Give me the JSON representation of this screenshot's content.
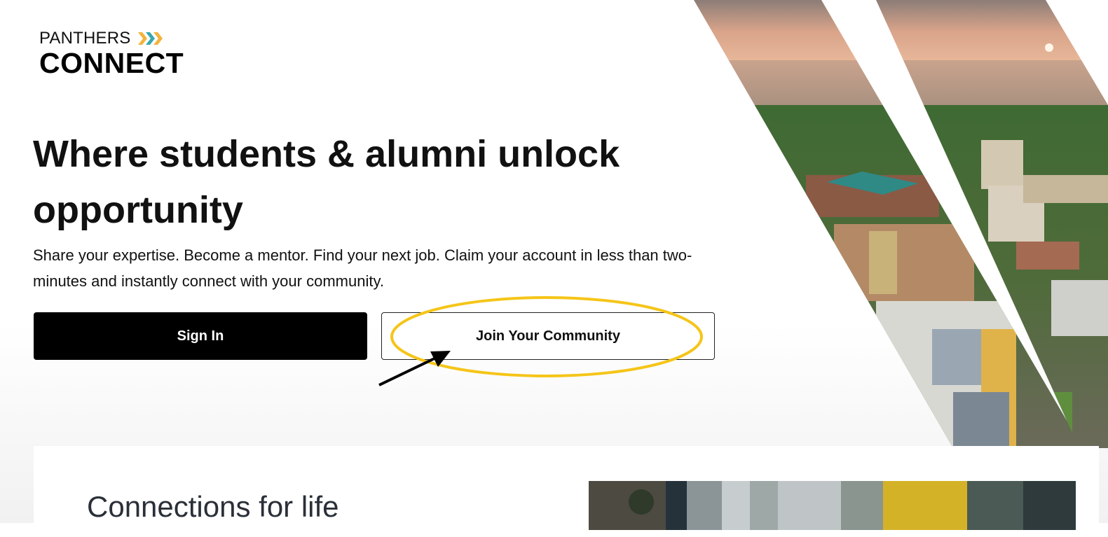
{
  "logo": {
    "top_text": "PANTHERS",
    "bottom_text": "CONNECT",
    "chevron_colors": [
      "#f3b33d",
      "#3aa8b0",
      "#f3b33d"
    ]
  },
  "hero": {
    "headline": "Where students & alumni unlock opportunity",
    "subtext": "Share your expertise. Become a mentor. Find your next job. Claim your account in less than two-minutes and instantly connect with your community.",
    "sign_in_label": "Sign In",
    "join_label": "Join Your Community"
  },
  "section": {
    "title": "Connections for life"
  },
  "colors": {
    "primary_button": "#000000",
    "annotation_highlight": "#f5c518",
    "annotation_arrow": "#000000"
  }
}
